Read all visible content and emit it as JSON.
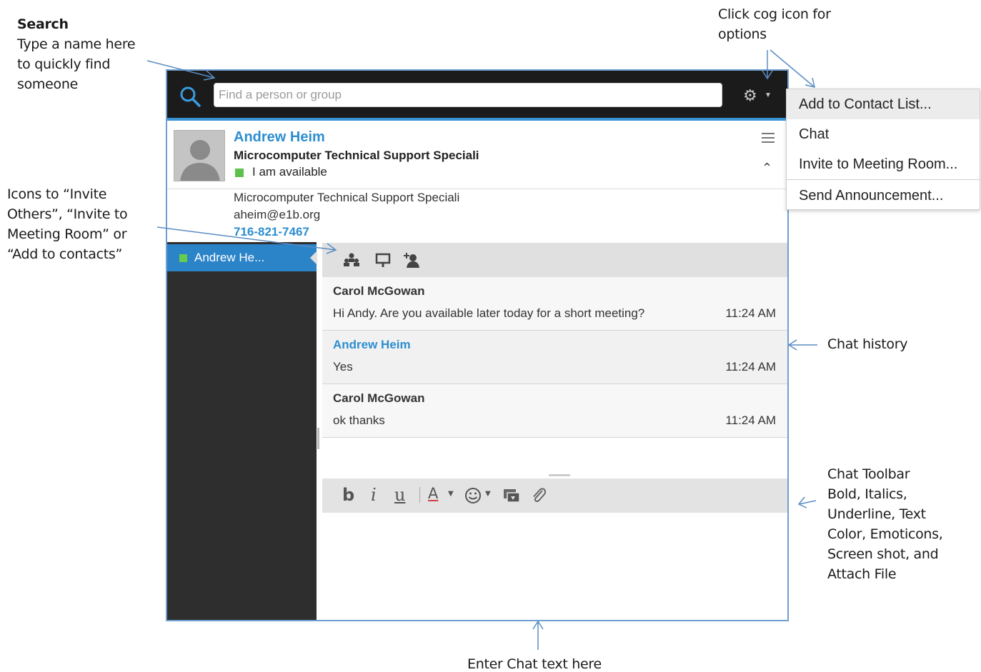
{
  "annotations": {
    "search": {
      "heading": "Search",
      "lines": [
        "Type a name here",
        "to quickly find",
        "someone"
      ]
    },
    "cog": {
      "lines": [
        "Click cog icon for",
        "options"
      ]
    },
    "icons": {
      "lines": [
        "Icons to “Invite",
        "Others”, “Invite to",
        "Meeting Room” or",
        "“Add to contacts”"
      ]
    },
    "history": {
      "text": "Chat history"
    },
    "toolbar": {
      "lines": [
        "Chat Toolbar",
        "Bold, Italics,",
        "Underline, Text",
        "Color, Emoticons,",
        "Screen shot, and",
        "Attach File"
      ]
    },
    "enter": {
      "text": "Enter Chat text here"
    }
  },
  "search": {
    "placeholder": "Find a person or group"
  },
  "contact": {
    "name": "Andrew Heim",
    "title": "Microcomputer Technical Support Speciali",
    "status": "I am available",
    "detail_title": "Microcomputer Technical Support Speciali",
    "email": "aheim@e1b.org",
    "phone": "716-821-7467"
  },
  "sidebar": {
    "items": [
      {
        "label": "Andrew He..."
      }
    ]
  },
  "messages": [
    {
      "sender": "Carol McGowan",
      "text": "Hi Andy.  Are you available later today for a short meeting?",
      "time": "11:24 AM"
    },
    {
      "sender": "Andrew Heim",
      "text": "Yes",
      "time": "11:24 AM"
    },
    {
      "sender": "Carol McGowan",
      "text": "ok thanks",
      "time": "11:24 AM"
    }
  ],
  "format": {
    "bold": "b",
    "italic": "i",
    "underline": "u",
    "text_color": "A"
  },
  "options_menu": {
    "items": [
      {
        "label": "Add to Contact List..."
      },
      {
        "label": "Chat"
      },
      {
        "label": "Invite to Meeting Room..."
      },
      {
        "label": "Send Announcement..."
      }
    ]
  },
  "icons": {
    "search": "search-icon",
    "cog": "cog-icon",
    "menu": "menu-icon",
    "collapse": "collapse-icon",
    "invite_others": "invite-others-icon",
    "meeting_room": "meeting-room-icon",
    "add_contact": "add-contact-icon",
    "emoticon": "emoticon-icon",
    "screenshot": "screenshot-icon",
    "attach": "attach-icon"
  },
  "colors": {
    "accent": "#2d8ed0",
    "topbar": "#1b1b1b",
    "sidebar": "#2e2e2e",
    "selected_item": "#2b84c8",
    "available": "#5ec14d"
  }
}
